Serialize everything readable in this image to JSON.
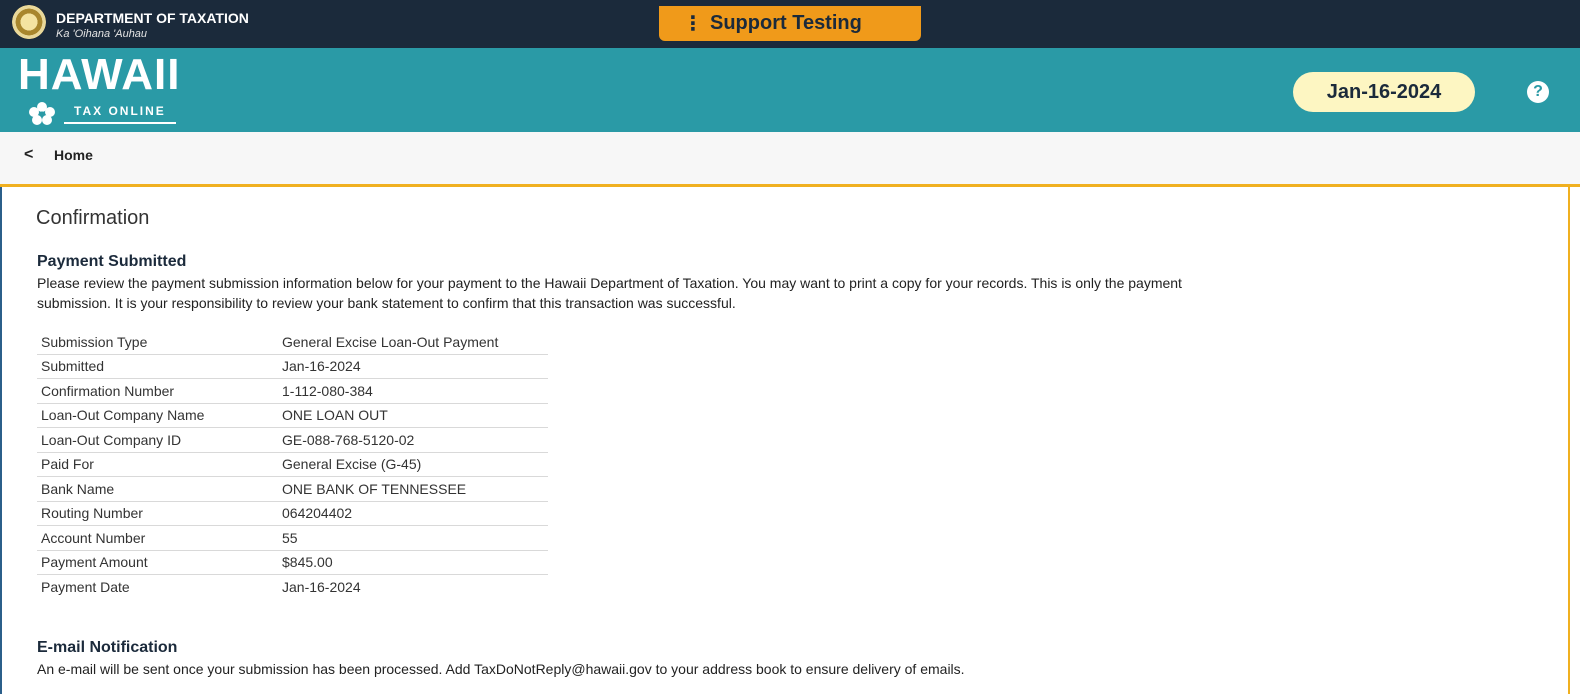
{
  "topbar": {
    "dept_title": "DEPARTMENT OF TAXATION",
    "dept_subtitle": "Ka 'Oihana 'Auhau",
    "support_label": "Support Testing",
    "kebab_glyph": "⋮"
  },
  "header": {
    "logo_main": "HAWAII",
    "logo_sub": "TAX ONLINE",
    "date": "Jan-16-2024",
    "help_glyph": "?"
  },
  "breadcrumb": {
    "back_glyph": "<",
    "home_label": "Home"
  },
  "page": {
    "title": "Confirmation",
    "payment_heading": "Payment Submitted",
    "payment_text_1": "Please review the payment submission information below for your payment to the Hawaii Department of Taxation. You may want to print a copy for your records. This is only the payment",
    "payment_text_2": "submission. It is your responsibility to review your bank statement to confirm that this transaction was successful.",
    "summary": [
      {
        "label": "Submission Type",
        "value": "General Excise Loan-Out Payment"
      },
      {
        "label": "Submitted",
        "value": "Jan-16-2024"
      },
      {
        "label": "Confirmation Number",
        "value": "1-112-080-384"
      },
      {
        "label": "Loan-Out Company Name",
        "value": "ONE LOAN OUT"
      },
      {
        "label": "Loan-Out Company ID",
        "value": "GE-088-768-5120-02"
      },
      {
        "label": "Paid For",
        "value": "General Excise (G-45)"
      },
      {
        "label": "Bank Name",
        "value": "ONE BANK OF TENNESSEE"
      },
      {
        "label": "Routing Number",
        "value": "064204402"
      },
      {
        "label": "Account Number",
        "value": "55"
      },
      {
        "label": "Payment Amount",
        "value": "$845.00"
      },
      {
        "label": "Payment Date",
        "value": "Jan-16-2024"
      }
    ],
    "email_heading": "E-mail Notification",
    "email_text": "An e-mail will be sent once your submission has been processed. Add TaxDoNotReply@hawaii.gov to your address book to ensure delivery of emails."
  },
  "colors": {
    "topbar": "#1b2a3b",
    "header_teal": "#2a9aa6",
    "support_orange": "#f09a1a",
    "date_pill": "#fdf6c2",
    "accent_gold": "#f0b020"
  },
  "icons": {
    "seal": "state-seal-icon",
    "flower": "hibiscus-icon",
    "help": "help-icon",
    "kebab": "kebab-menu-icon",
    "back": "chevron-left-icon"
  }
}
